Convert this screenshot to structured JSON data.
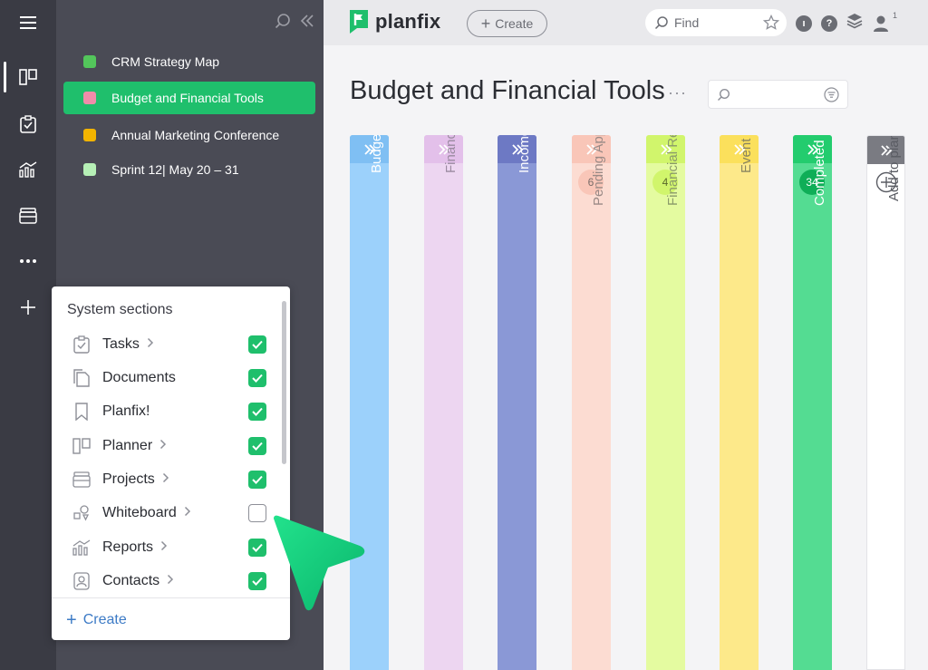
{
  "colors": {
    "rail_bg": "#3a3b44",
    "sidebar_bg": "#4a4b55",
    "accent_green": "#1fbf6c",
    "link_blue": "#3d7bc6"
  },
  "rail": {
    "items": [
      {
        "name": "menu",
        "icon": "hamburger-icon"
      },
      {
        "name": "planner",
        "icon": "planner-icon",
        "active": true
      },
      {
        "name": "tasks",
        "icon": "task-check-icon"
      },
      {
        "name": "reports",
        "icon": "chart-icon"
      },
      {
        "name": "projects",
        "icon": "projects-icon"
      },
      {
        "name": "more",
        "icon": "more-icon"
      },
      {
        "name": "add",
        "icon": "plus-icon"
      }
    ]
  },
  "sidebar": {
    "items": [
      {
        "label": "CRM Strategy Map",
        "color": "#53c65b"
      },
      {
        "label": "Budget and Financial Tools",
        "color": "#f08caa",
        "active": true
      },
      {
        "label": "Annual Marketing Conference",
        "color": "#f2b400"
      },
      {
        "label": "Sprint 12| May 20 – 31",
        "color": "#b6f0b6"
      }
    ]
  },
  "topbar": {
    "logo_text": "planfix",
    "create_label": "Create",
    "find_placeholder": "Find",
    "user_count": "1"
  },
  "main": {
    "title": "Budget and Financial Tools",
    "more": "···",
    "search_value": ""
  },
  "columns": [
    {
      "label": "Budget Planning",
      "color": "#9cd1fb",
      "head": "#7fbff3",
      "text": "#ffffff"
    },
    {
      "label": "Financial Management",
      "color": "#edd6f1",
      "head": "#e3c0ea",
      "text": "#9a8aa0"
    },
    {
      "label": "Income and Expenses",
      "color": "#8a98d6",
      "head": "#6d79c4",
      "text": "#ffffff"
    },
    {
      "label": "Pending Approval",
      "color": "#fcdcd2",
      "head": "#f9c6b8",
      "text": "#9a8a86",
      "badge": "6",
      "badge_bg": "#f9c6b8",
      "badge_color": "#7a6c68"
    },
    {
      "label": "Financial Reports",
      "color": "#e4fba0",
      "head": "#d1f56c",
      "text": "#8a9a6a",
      "badge": "4",
      "badge_bg": "#d1f56c",
      "badge_color": "#5a6a2a"
    },
    {
      "label": "Event participants",
      "color": "#fde98a",
      "head": "#fbe05c",
      "text": "#8a8560"
    },
    {
      "label": "Completed",
      "color": "#54dc92",
      "head": "#23cc6e",
      "text": "#ffffff",
      "badge": "34",
      "badge_bg": "#0fae57",
      "badge_color": "#ffffff"
    },
    {
      "label": "Add to planner",
      "color": "#ffffff",
      "head": "#7a7b82",
      "text": "#5a5c63"
    }
  ],
  "popup": {
    "title": "System sections",
    "create_label": "Create",
    "items": [
      {
        "label": "Tasks",
        "icon": "task-check-icon",
        "chevron": true,
        "checked": true
      },
      {
        "label": "Documents",
        "icon": "documents-icon",
        "chevron": false,
        "checked": true
      },
      {
        "label": "Planfix!",
        "icon": "bookmark-icon",
        "chevron": false,
        "checked": true
      },
      {
        "label": "Planner",
        "icon": "planner-icon",
        "chevron": true,
        "checked": true
      },
      {
        "label": "Projects",
        "icon": "projects-icon",
        "chevron": true,
        "checked": true
      },
      {
        "label": "Whiteboard",
        "icon": "whiteboard-icon",
        "chevron": true,
        "checked": false
      },
      {
        "label": "Reports",
        "icon": "chart-icon",
        "chevron": true,
        "checked": true
      },
      {
        "label": "Contacts",
        "icon": "contacts-icon",
        "chevron": true,
        "checked": true
      }
    ]
  }
}
